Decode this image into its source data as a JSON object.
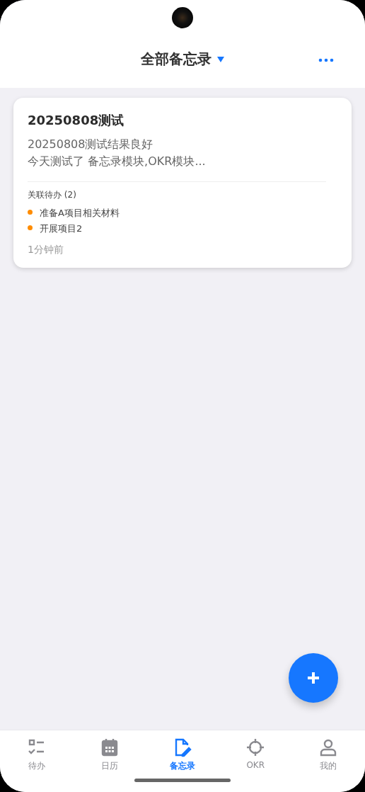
{
  "header": {
    "title": "全部备忘录"
  },
  "memos": [
    {
      "title": "20250808测试",
      "preview": [
        "20250808测试结果良好",
        "今天测试了 备忘录模块,OKR模块..."
      ],
      "todos_label": "关联待办 (2)",
      "todos": [
        "准备A项目相关材料",
        "开展项目2"
      ],
      "time": "1分钟前"
    }
  ],
  "tabs": [
    {
      "label": "待办",
      "kind": "todo",
      "selected": false
    },
    {
      "label": "日历",
      "kind": "calendar",
      "selected": false
    },
    {
      "label": "备忘录",
      "kind": "memo",
      "selected": true
    },
    {
      "label": "OKR",
      "kind": "target",
      "selected": false
    },
    {
      "label": "我的",
      "kind": "profile",
      "selected": false
    }
  ]
}
